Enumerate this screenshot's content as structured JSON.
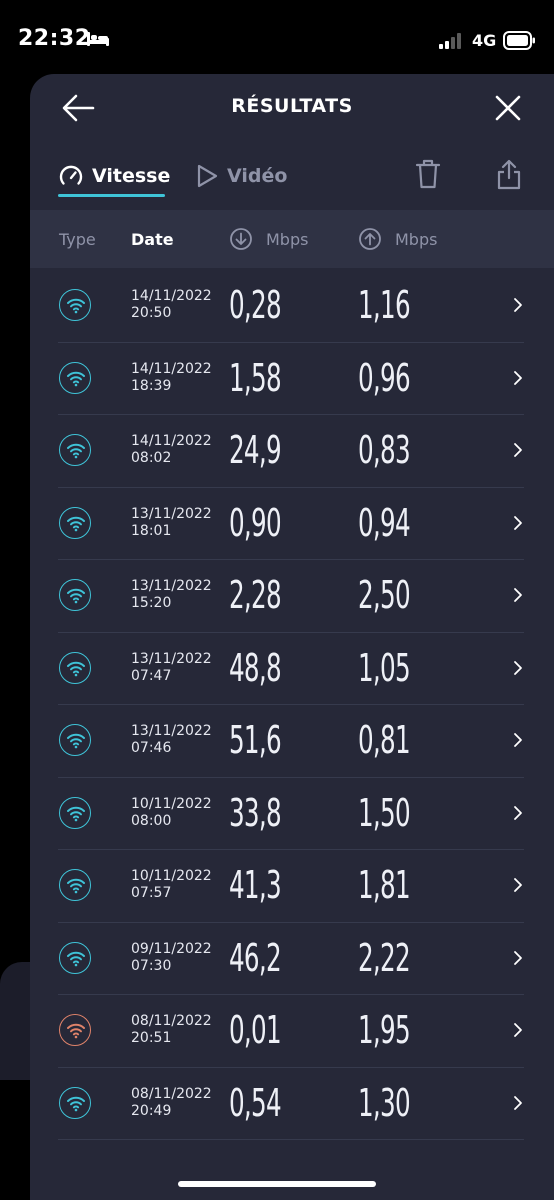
{
  "status_bar": {
    "time": "22:32",
    "network": "4G"
  },
  "header": {
    "title": "RÉSULTATS"
  },
  "tabs": {
    "speed_label": "Vitesse",
    "video_label": "Vidéo"
  },
  "columns": {
    "type": "Type",
    "date": "Date",
    "download": "Mbps",
    "upload": "Mbps"
  },
  "colors": {
    "accent": "#3fc4d8",
    "warning": "#e0836a",
    "panel": "#262838"
  },
  "results": [
    {
      "date": "14/11/2022",
      "time": "20:50",
      "download": "0,28",
      "upload": "1,16",
      "status": "normal"
    },
    {
      "date": "14/11/2022",
      "time": "18:39",
      "download": "1,58",
      "upload": "0,96",
      "status": "normal"
    },
    {
      "date": "14/11/2022",
      "time": "08:02",
      "download": "24,9",
      "upload": "0,83",
      "status": "normal"
    },
    {
      "date": "13/11/2022",
      "time": "18:01",
      "download": "0,90",
      "upload": "0,94",
      "status": "normal"
    },
    {
      "date": "13/11/2022",
      "time": "15:20",
      "download": "2,28",
      "upload": "2,50",
      "status": "normal"
    },
    {
      "date": "13/11/2022",
      "time": "07:47",
      "download": "48,8",
      "upload": "1,05",
      "status": "normal"
    },
    {
      "date": "13/11/2022",
      "time": "07:46",
      "download": "51,6",
      "upload": "0,81",
      "status": "normal"
    },
    {
      "date": "10/11/2022",
      "time": "08:00",
      "download": "33,8",
      "upload": "1,50",
      "status": "normal"
    },
    {
      "date": "10/11/2022",
      "time": "07:57",
      "download": "41,3",
      "upload": "1,81",
      "status": "normal"
    },
    {
      "date": "09/11/2022",
      "time": "07:30",
      "download": "46,2",
      "upload": "2,22",
      "status": "normal"
    },
    {
      "date": "08/11/2022",
      "time": "20:51",
      "download": "0,01",
      "upload": "1,95",
      "status": "warning"
    },
    {
      "date": "08/11/2022",
      "time": "20:49",
      "download": "0,54",
      "upload": "1,30",
      "status": "normal"
    }
  ]
}
